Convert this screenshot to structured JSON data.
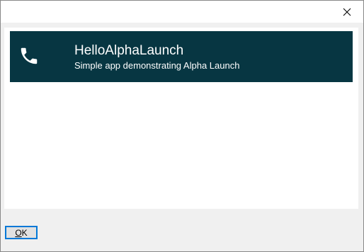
{
  "dialog": {
    "close_icon": "close-icon"
  },
  "banner": {
    "icon": "phone-icon",
    "title": "HelloAlphaLaunch",
    "subtitle": "Simple app demonstrating Alpha Launch",
    "background_color": "#073642"
  },
  "footer": {
    "ok_mnemonic": "O",
    "ok_rest": "K"
  }
}
